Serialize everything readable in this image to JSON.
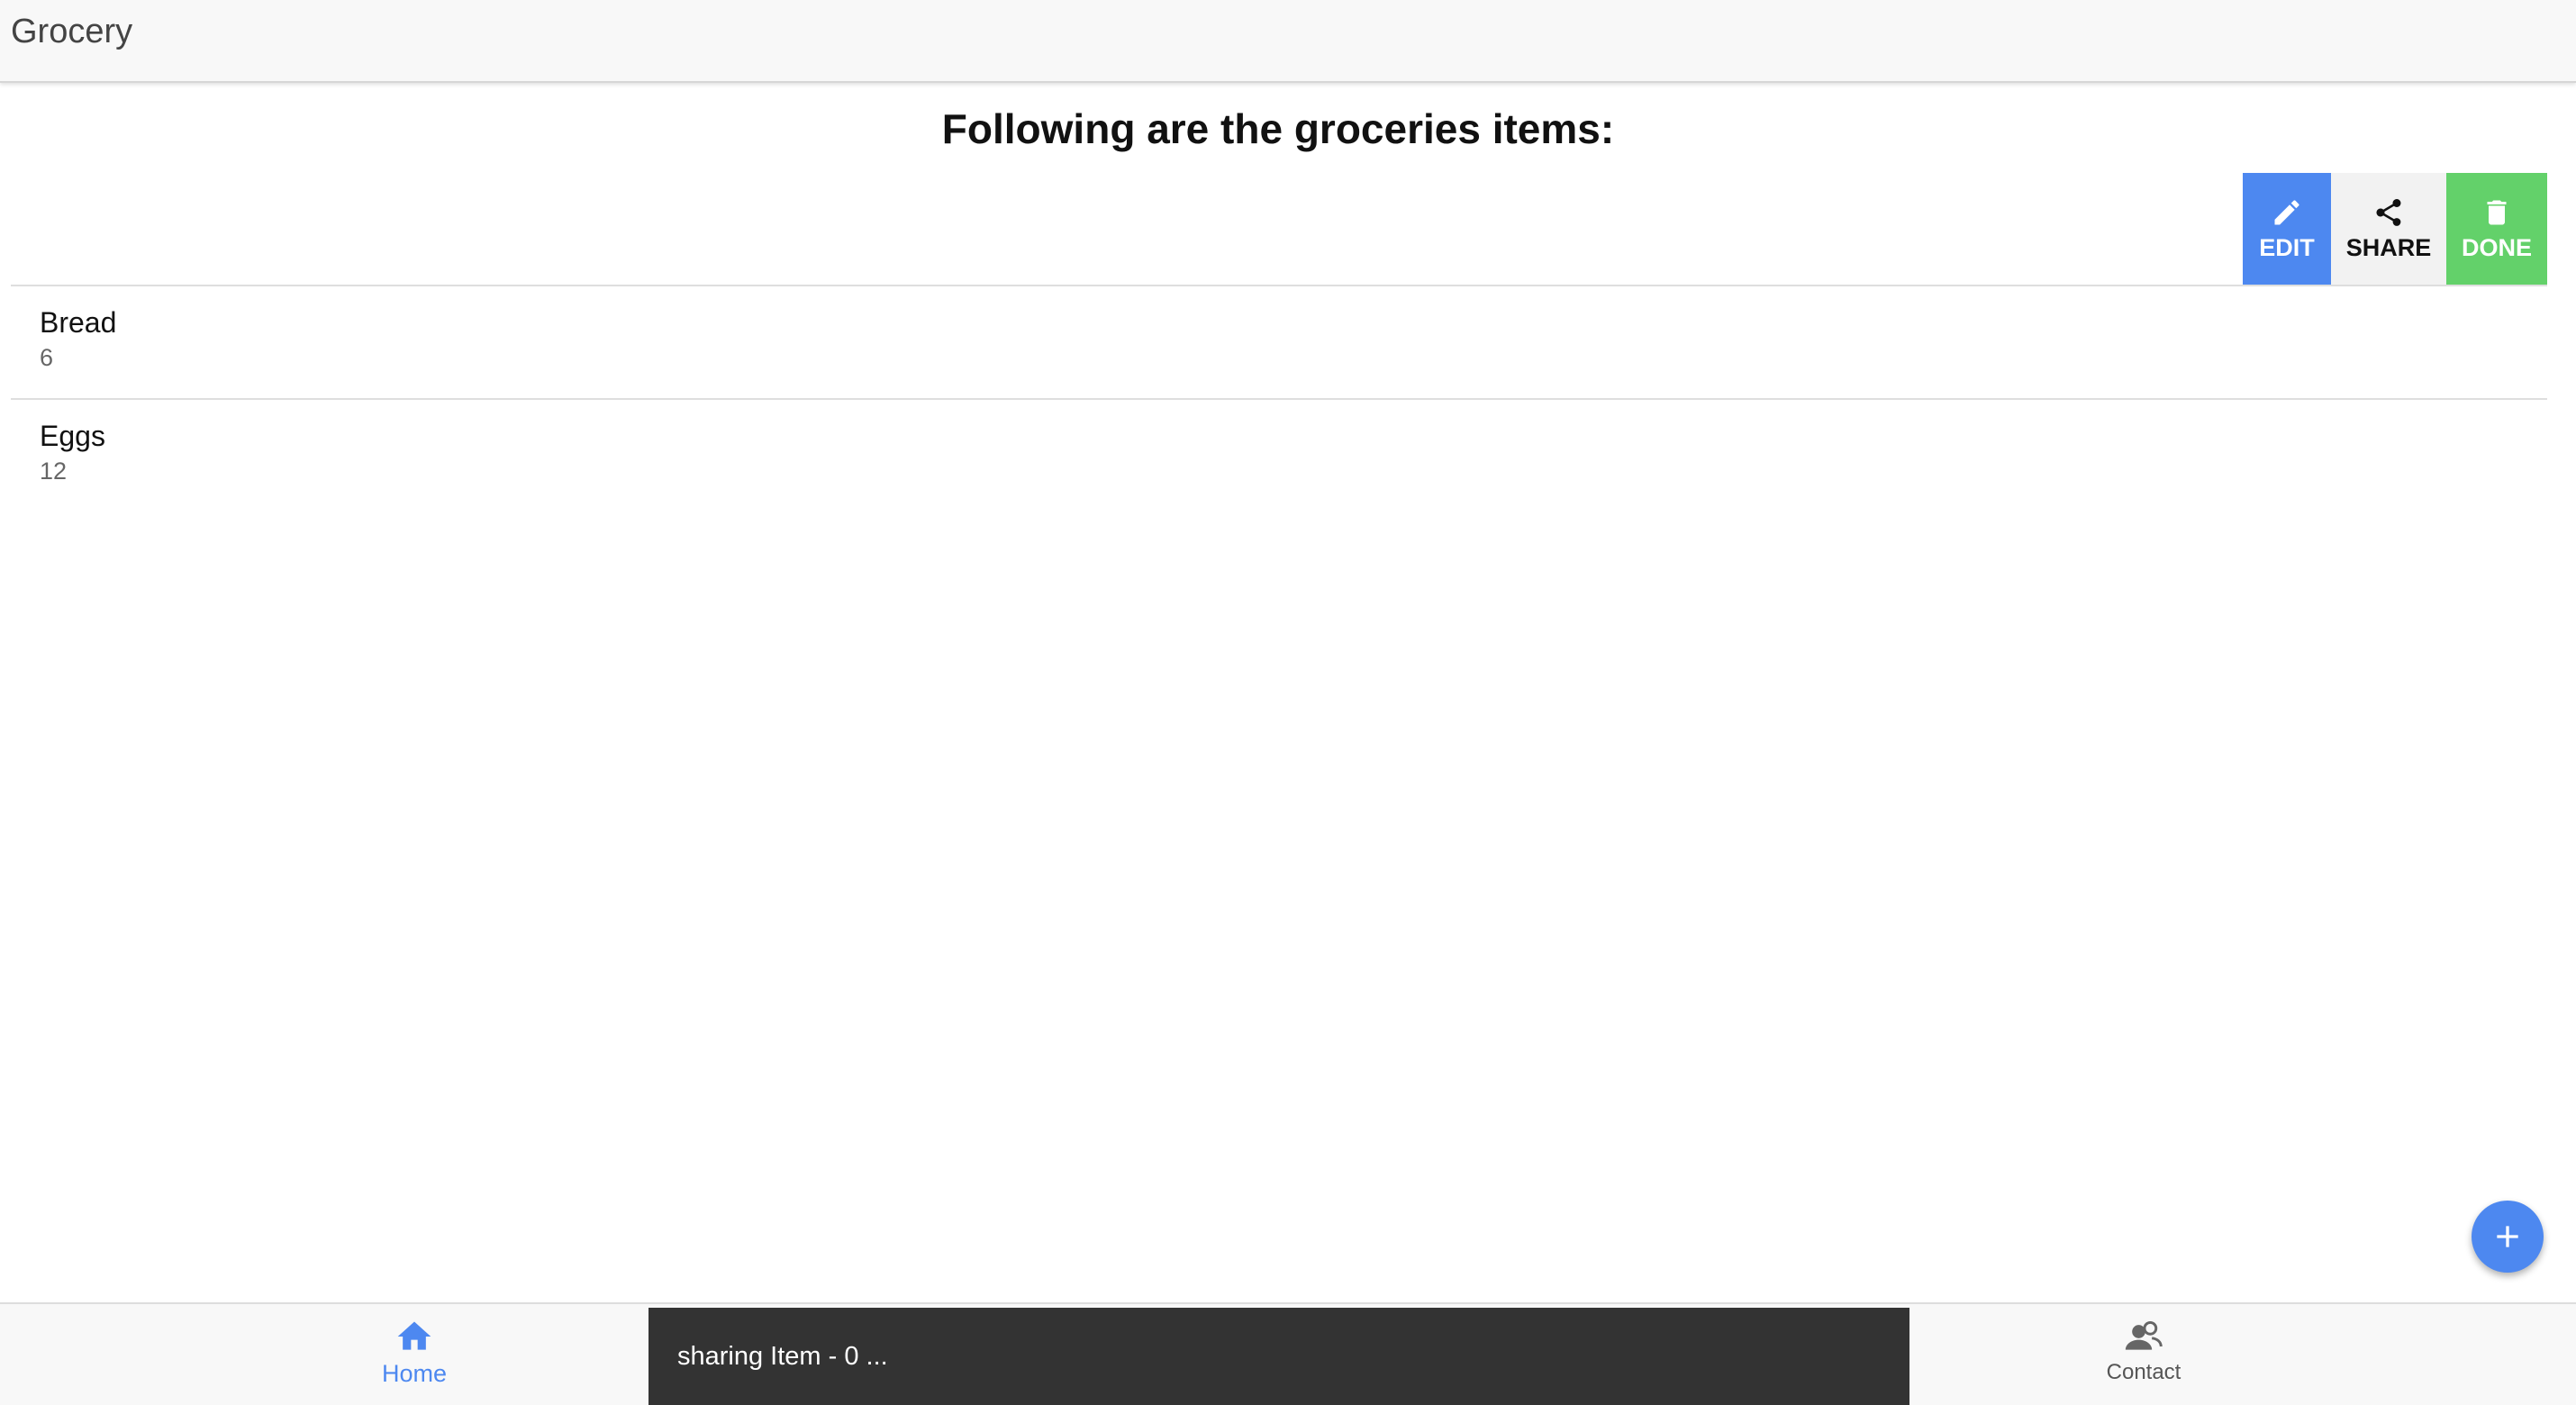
{
  "header": {
    "title": "Grocery"
  },
  "main": {
    "heading": "Following are the groceries items:"
  },
  "swipe_actions": {
    "edit_label": "EDIT",
    "share_label": "SHARE",
    "done_label": "DONE",
    "colors": {
      "edit": "#4d88f0",
      "share": "#f2f2f2",
      "done": "#63d16a"
    }
  },
  "items": [
    {
      "name": "Bread",
      "quantity": "6"
    },
    {
      "name": "Eggs",
      "quantity": "12"
    }
  ],
  "fab": {
    "icon": "plus-icon"
  },
  "tabs": [
    {
      "label": "Home",
      "icon": "home-icon",
      "active": true
    },
    {
      "label": "Contact",
      "icon": "contacts-icon",
      "active": false
    }
  ],
  "toast": {
    "message": "sharing Item - 0 ..."
  },
  "colors": {
    "accent": "#4d88f0",
    "toast_bg": "#333333"
  }
}
